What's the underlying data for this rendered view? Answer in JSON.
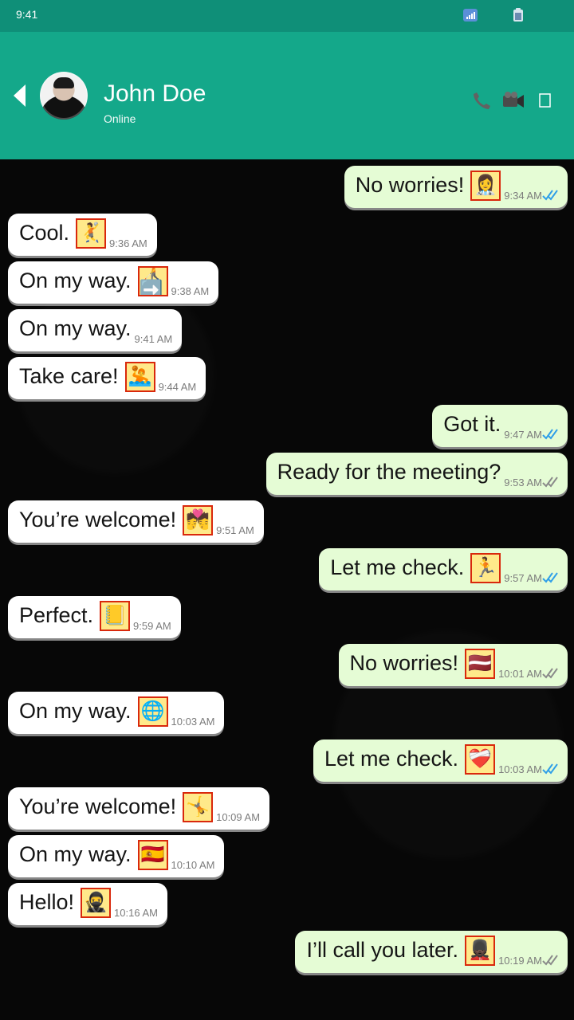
{
  "status": {
    "time": "9:41"
  },
  "header": {
    "contact_name": "John Doe",
    "contact_status": "Online"
  },
  "messages": [
    {
      "direction": "sent",
      "text": "No worries!",
      "emoji": "👩‍⚕️",
      "time": "9:34 AM",
      "status": "read"
    },
    {
      "direction": "received",
      "text": "Cool.",
      "emoji": "🤾",
      "time": "9:36 AM"
    },
    {
      "direction": "received",
      "text": "On my way.",
      "emoji": "🧑‍🦯➡️",
      "time": "9:38 AM"
    },
    {
      "direction": "received",
      "text": "On my way.",
      "time": "9:41 AM"
    },
    {
      "direction": "received",
      "text": "Take care!",
      "emoji": "🤽",
      "time": "9:44 AM"
    },
    {
      "direction": "sent",
      "text": "Got it.",
      "time": "9:47 AM",
      "status": "read"
    },
    {
      "direction": "sent",
      "text": "Ready for the meeting?",
      "time": "9:53 AM",
      "status": "delivered"
    },
    {
      "direction": "received",
      "text": "You’re welcome!",
      "emoji": "💏",
      "time": "9:51 AM"
    },
    {
      "direction": "sent",
      "text": "Let me check.",
      "emoji": "🏃",
      "time": "9:57 AM",
      "status": "read"
    },
    {
      "direction": "received",
      "text": "Perfect.",
      "emoji": "📒",
      "time": "9:59 AM"
    },
    {
      "direction": "sent",
      "text": "No worries!",
      "emoji": "🇱🇻",
      "time": "10:01 AM",
      "status": "delivered"
    },
    {
      "direction": "received",
      "text": "On my way.",
      "emoji": "🌐",
      "time": "10:03 AM"
    },
    {
      "direction": "sent",
      "text": "Let me check.",
      "emoji": "❤️‍🩹",
      "time": "10:03 AM",
      "status": "read"
    },
    {
      "direction": "received",
      "text": "You’re welcome!",
      "emoji": "🤸",
      "time": "10:09 AM"
    },
    {
      "direction": "received",
      "text": "On my way.",
      "emoji": "🇪🇸",
      "time": "10:10 AM"
    },
    {
      "direction": "received",
      "text": "Hello!",
      "emoji": "🥷",
      "time": "10:16 AM"
    },
    {
      "direction": "sent",
      "text": "I’ll call you later.",
      "emoji": "💂🏿",
      "time": "10:19 AM",
      "status": "delivered"
    }
  ],
  "colors": {
    "header": "#14a88a",
    "status_bar": "#0f8f78",
    "background": "#070707",
    "sent_bubble": "#e5fcd5",
    "received_bubble": "#ffffff",
    "read_tick": "#2f9fe8",
    "delivered_tick": "#8a8a8a"
  },
  "icons": {
    "back": "back-arrow-icon",
    "call": "phone-icon",
    "video": "video-camera-icon",
    "menu": "menu-icon",
    "signal": "signal-icon",
    "battery": "battery-icon"
  }
}
